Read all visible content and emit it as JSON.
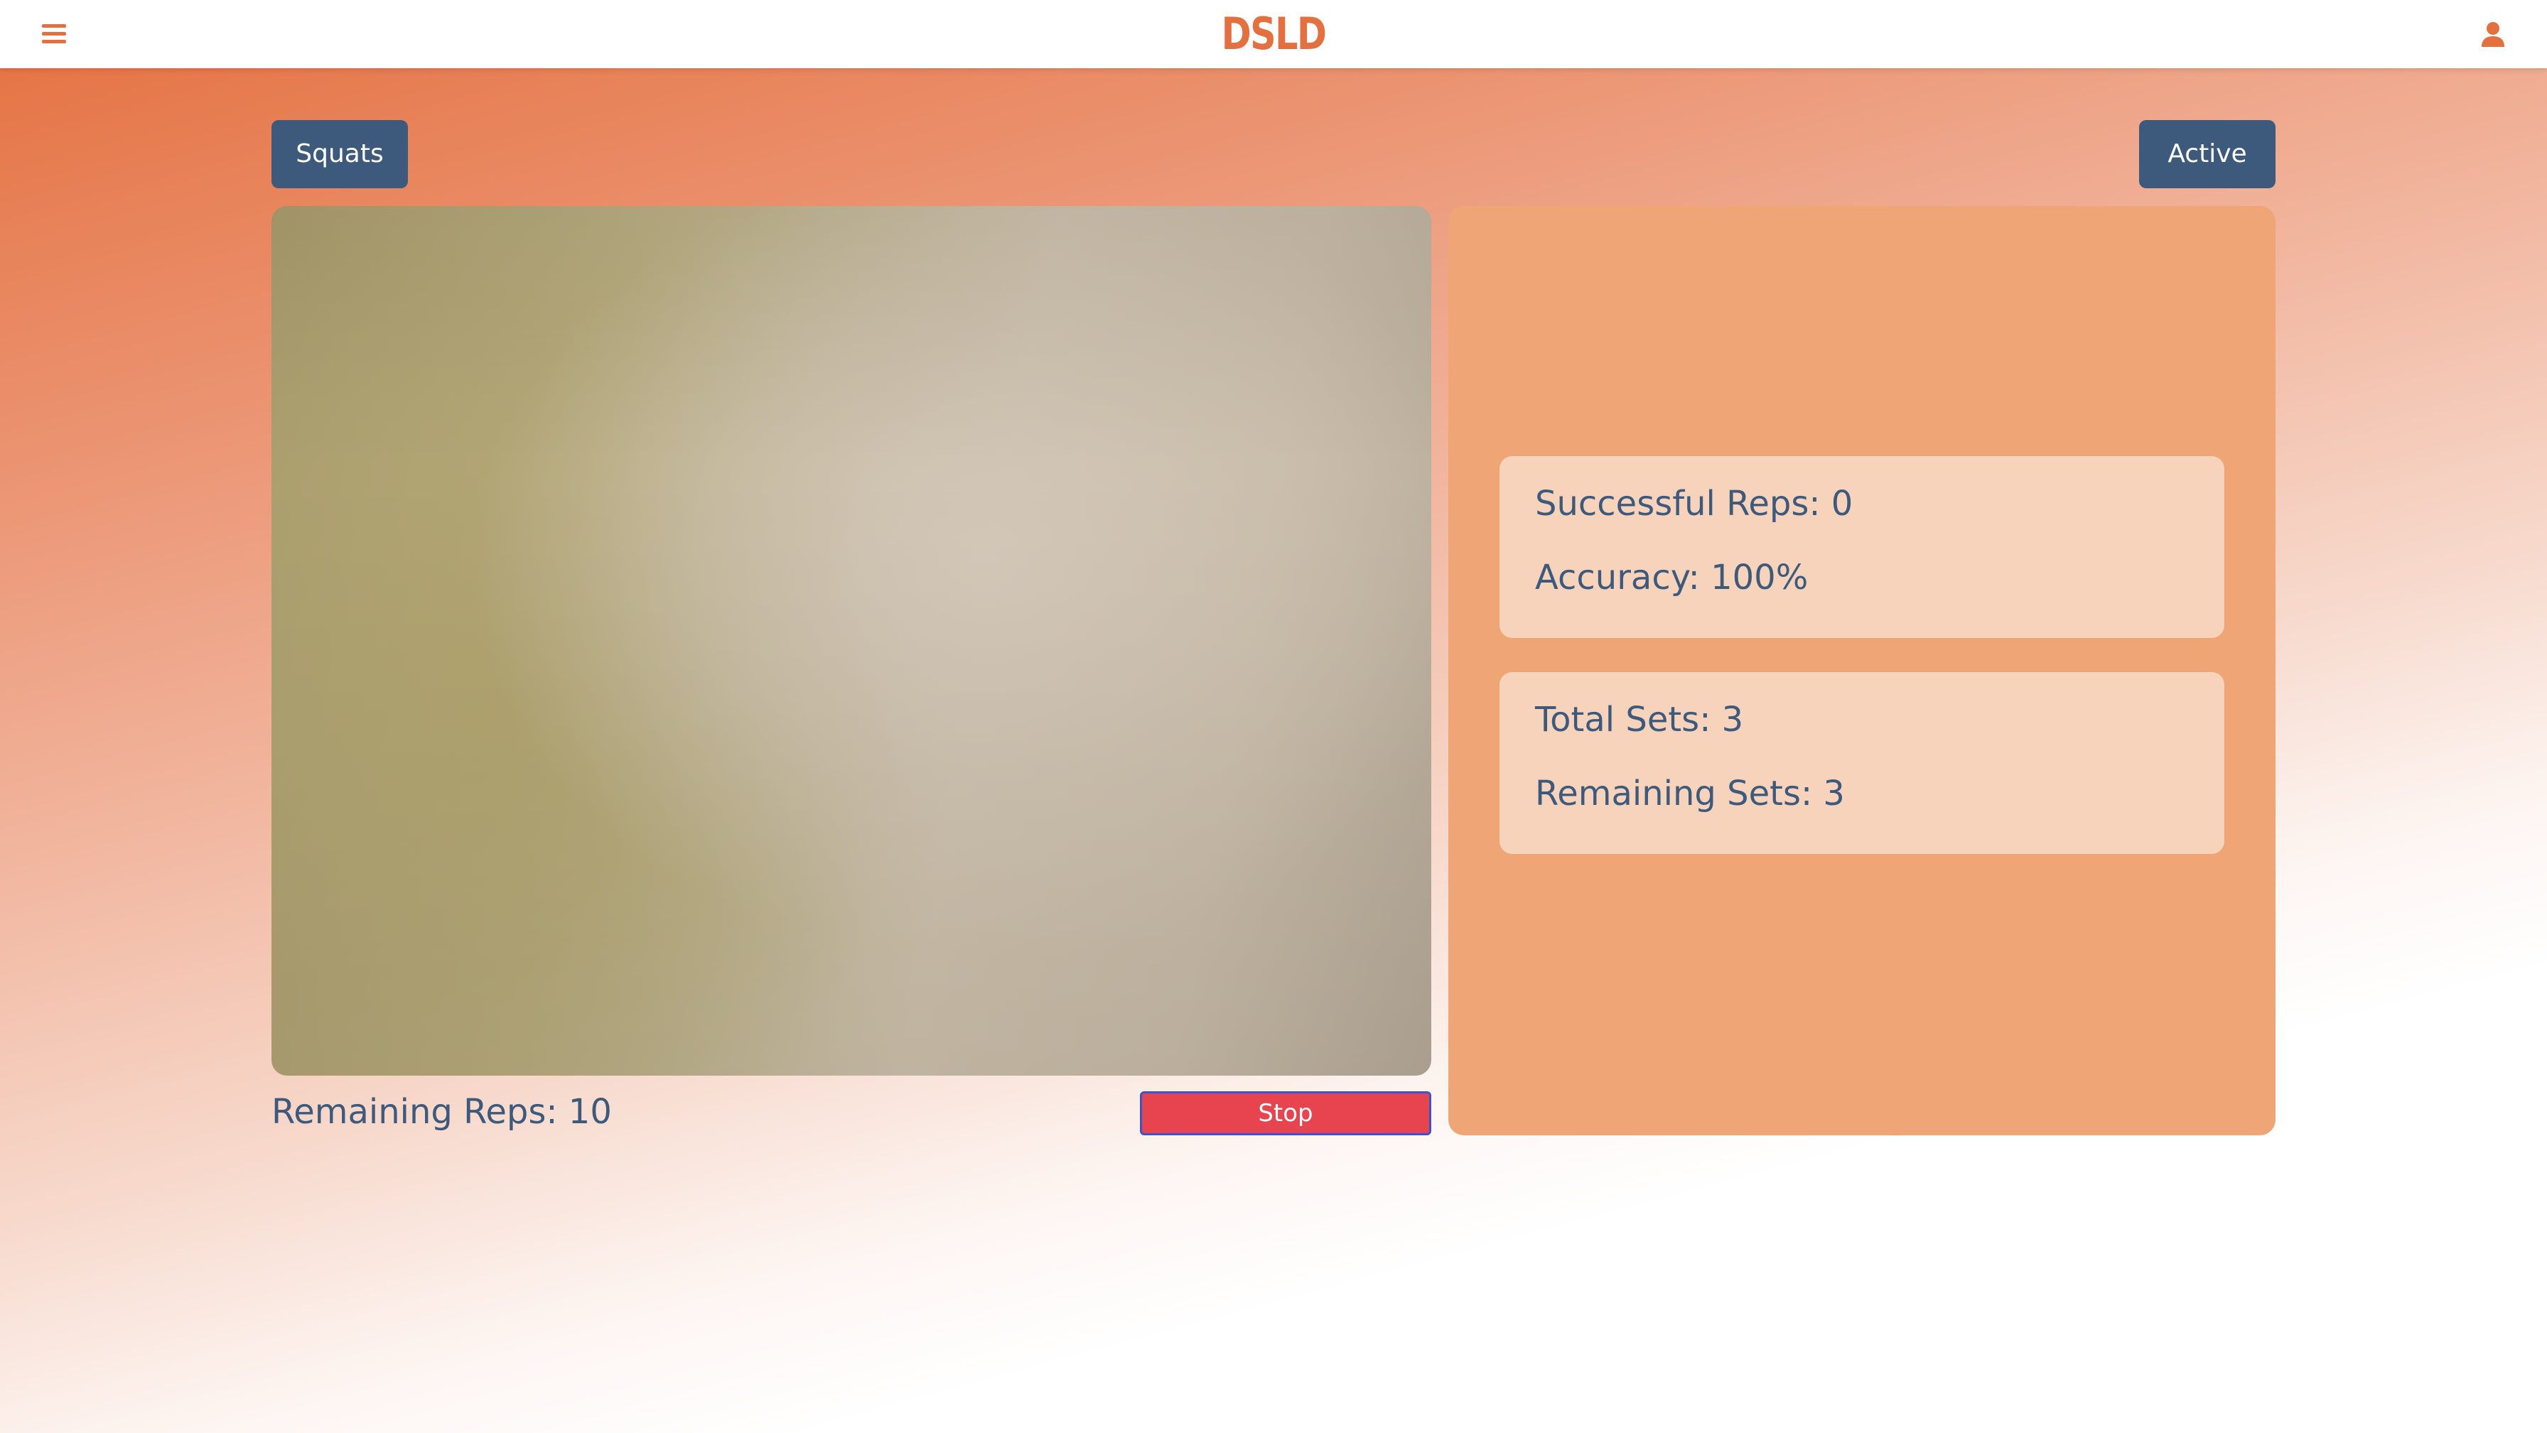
{
  "app": {
    "logo_text": "DSLD",
    "accent_color": "#e4703f",
    "primary_color": "#3d5a7d"
  },
  "navbar": {
    "menu_icon": "hamburger-menu-icon",
    "user_icon": "user-icon"
  },
  "controls": {
    "exercise_label": "Squats",
    "status_label": "Active",
    "stop_label": "Stop",
    "stop_color": "#e8444f"
  },
  "video": {
    "remaining_reps": "Remaining Reps: 10"
  },
  "stats": {
    "successful_reps": "Successful Reps: 0",
    "accuracy": "Accuracy: 100%",
    "total_sets": "Total Sets: 3",
    "remaining_sets": "Remaining Sets: 3"
  }
}
